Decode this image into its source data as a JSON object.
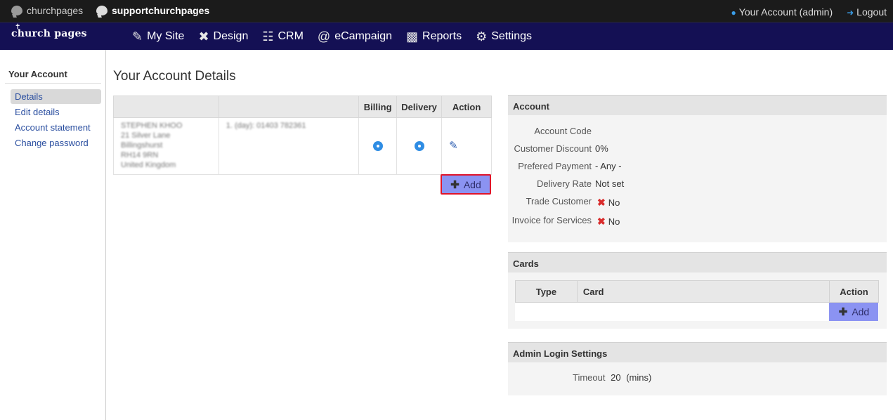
{
  "topbar": {
    "sites": [
      "churchpages",
      "supportchurchpages"
    ],
    "account_link": "Your Account (admin)",
    "logout_link": "Logout"
  },
  "navbar": {
    "logo": "church pages",
    "items": [
      {
        "label": "My Site",
        "icon": "site-edit-icon"
      },
      {
        "label": "Design",
        "icon": "design-tools-icon"
      },
      {
        "label": "CRM",
        "icon": "contacts-icon"
      },
      {
        "label": "eCampaign",
        "icon": "at-sign-icon"
      },
      {
        "label": "Reports",
        "icon": "bar-chart-icon"
      },
      {
        "label": "Settings",
        "icon": "gear-icon"
      }
    ]
  },
  "sidebar": {
    "title": "Your Account",
    "items": [
      "Details",
      "Edit details",
      "Account statement",
      "Change password"
    ],
    "active": "Details"
  },
  "main": {
    "title": "Your Account Details",
    "address_table": {
      "headers": [
        "",
        "",
        "Billing",
        "Delivery",
        "Action"
      ],
      "rows": [
        {
          "address_lines": [
            "STEPHEN KHOO",
            "21 Silver Lane",
            "Billingshurst",
            "RH14 9RN",
            "United Kingdom"
          ],
          "phone": "1. (day): 01403 782361",
          "billing": true,
          "delivery": true
        }
      ]
    },
    "add_button": "Add"
  },
  "account_panel": {
    "title": "Account",
    "fields": [
      {
        "label": "Account Code",
        "value": ""
      },
      {
        "label": "Customer Discount",
        "value": "0%"
      },
      {
        "label": "Prefered Payment",
        "value": "- Any -"
      },
      {
        "label": "Delivery Rate",
        "value": "Not set"
      },
      {
        "label": "Trade Customer",
        "value": "No"
      },
      {
        "label": "Invoice for Services",
        "value": "No"
      }
    ]
  },
  "cards_panel": {
    "title": "Cards",
    "headers": [
      "Type",
      "Card",
      "Action"
    ],
    "add_button": "Add"
  },
  "admin_panel": {
    "title": "Admin Login Settings",
    "timeout_label": "Timeout",
    "timeout_value": "20",
    "timeout_unit": "(mins)"
  },
  "colors": {
    "nav_bg": "#141054",
    "topbar_bg": "#1b1b1b",
    "add_button": "#8b93f2",
    "highlight": "#e0142a"
  }
}
